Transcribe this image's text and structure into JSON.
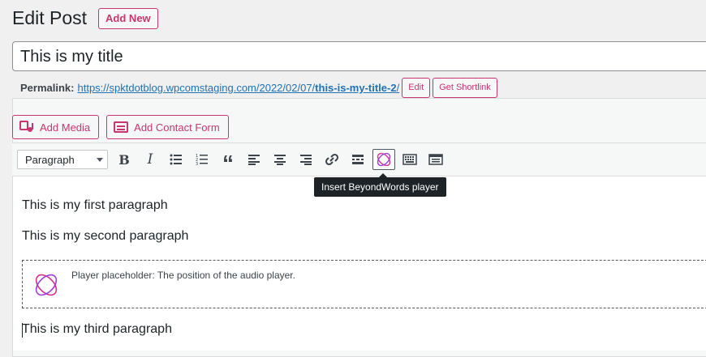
{
  "header": {
    "title": "Edit Post",
    "add_new_label": "Add New"
  },
  "title_field": {
    "value": "This is my title"
  },
  "permalink": {
    "label": "Permalink:",
    "url_base": "https://spktdotblog.wpcomstaging.com/2022/02/07/",
    "slug": "this-is-my-title-2",
    "url_trail": "/",
    "edit_label": "Edit",
    "shortlink_label": "Get Shortlink"
  },
  "media_buttons": {
    "add_media": "Add Media",
    "add_contact_form": "Add Contact Form"
  },
  "toolbar": {
    "format_select": "Paragraph",
    "buttons": [
      "bold",
      "italic",
      "bulleted-list",
      "numbered-list",
      "blockquote",
      "align-left",
      "align-center",
      "align-right",
      "link",
      "read-more",
      "beyondwords-player",
      "toolbar-toggle",
      "contact-form"
    ]
  },
  "tooltip": {
    "text": "Insert BeyondWords player"
  },
  "editor": {
    "paragraph_1": "This is my first paragraph",
    "paragraph_2": "This is my second paragraph",
    "placeholder_text": "Player placeholder: The position of the audio player.",
    "paragraph_3": "This is my third paragraph"
  },
  "colors": {
    "accent": "#c9356e",
    "link": "#2271b1",
    "beyondwords_icon": "#d62f8e"
  }
}
